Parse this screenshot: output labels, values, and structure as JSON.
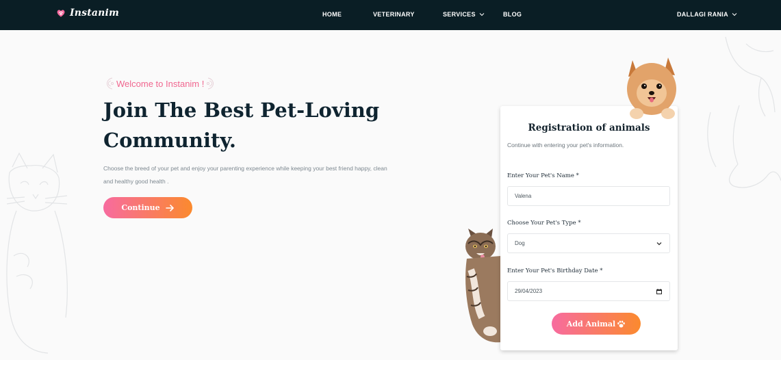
{
  "nav": {
    "brand": "Instanim",
    "brand_icon": "paw-heart-icon",
    "items": [
      {
        "label": "HOME"
      },
      {
        "label": "VETERINARY"
      },
      {
        "label": "SERVICES",
        "has_dropdown": true
      },
      {
        "label": "BLOG"
      }
    ],
    "user": {
      "name": "DALLAGI RANIA",
      "has_dropdown": true
    }
  },
  "hero": {
    "welcome": "Welcome to Instanim !",
    "title": "Join The Best Pet-Loving Community.",
    "subtitle": "Choose the breed of your pet and enjoy your parenting experience while keeping your best friend happy, clean and healthy good health .",
    "cta_label": "Continue",
    "cta_icon": "arrow-right-icon"
  },
  "form": {
    "title": "Registration of animals",
    "subtitle": "Continue with entering your pet's information.",
    "name_label": "Enter Your Pet's Name *",
    "name_value": "Valena",
    "type_label": "Choose Your Pet's Type *",
    "type_value": "Dog",
    "birthday_label": "Enter Your Pet's Birthday Date *",
    "birthday_value": "29/04/2023",
    "submit_label": "Add Animal",
    "submit_icon": "paw-icon"
  },
  "colors": {
    "nav_bg": "#0a1e25",
    "accent_pink": "#f76b9f",
    "accent_orange": "#fb8a2e",
    "welcome_pink": "#f0668f",
    "title_dark": "#0f2430"
  }
}
